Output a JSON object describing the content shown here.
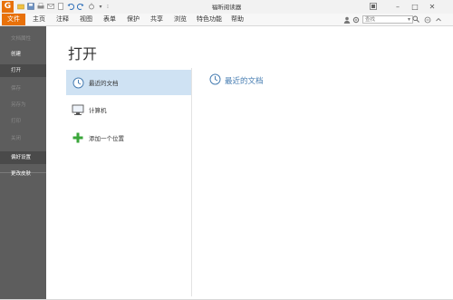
{
  "window": {
    "title": "福昕阅读器"
  },
  "menu": {
    "tabs": [
      {
        "label": "文件"
      },
      {
        "label": "主页"
      },
      {
        "label": "注释"
      },
      {
        "label": "视图"
      },
      {
        "label": "表单"
      },
      {
        "label": "保护"
      },
      {
        "label": "共享"
      },
      {
        "label": "浏览"
      },
      {
        "label": "特色功能"
      },
      {
        "label": "帮助"
      }
    ]
  },
  "search": {
    "placeholder": "查找"
  },
  "sidebar": {
    "items": [
      {
        "label": "文档属性"
      },
      {
        "label": "创建"
      },
      {
        "label": "打开"
      },
      {
        "label": "保存"
      },
      {
        "label": "另存为"
      },
      {
        "label": "打印"
      },
      {
        "label": "关闭"
      },
      {
        "label": "偏好设置"
      },
      {
        "label": "更改皮肤"
      }
    ]
  },
  "main": {
    "title": "打开",
    "places": [
      {
        "label": "最近的文档",
        "icon": "clock-icon"
      },
      {
        "label": "计算机",
        "icon": "computer-icon"
      },
      {
        "label": "添加一个位置",
        "icon": "plus-icon"
      }
    ],
    "content_header": "最近的文档"
  },
  "colors": {
    "brand_orange": "#e8710a",
    "sidebar_bg": "#5d5d5d",
    "selected_bg": "#cfe2f3",
    "link_blue": "#4a7fb3",
    "plus_green": "#3aa63a"
  }
}
